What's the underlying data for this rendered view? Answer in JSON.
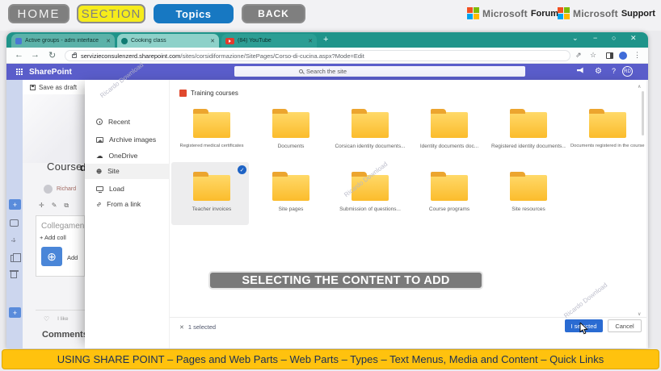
{
  "header": {
    "nav": [
      {
        "label": "HOME"
      },
      {
        "label": "SECTION"
      },
      {
        "label": "Topics"
      },
      {
        "label": "BACK"
      }
    ],
    "brands": [
      {
        "brand": "Microsoft",
        "label": "Forum"
      },
      {
        "brand": "Microsoft",
        "label": "Support"
      }
    ]
  },
  "browser": {
    "tabs": [
      {
        "title": "Active groups - adm interface"
      },
      {
        "title": "Cooking class"
      },
      {
        "title": "(84) YouTube"
      }
    ],
    "url_domain": "servizieconsulenzerd.sharepoint.com",
    "url_path": "/sites/corsidiformazione/SitePages/Corso-di-cucina.aspx?Mode=Edit"
  },
  "suitebar": {
    "app_name": "SharePoint",
    "search_placeholder": "Search the site",
    "avatar_initials": "RD"
  },
  "editor": {
    "save_as_draft": "Save as draft",
    "title": "Course",
    "title_overflow": "d",
    "author": "Richard",
    "links_heading": "Collegamen",
    "add_link": "+ Add coll",
    "add_button": "Add",
    "like_label": "I like",
    "comments_label": "Comments"
  },
  "picker": {
    "sidebar": [
      {
        "label": "Recent"
      },
      {
        "label": "Archive images"
      },
      {
        "label": "OneDrive"
      },
      {
        "label": "Site"
      },
      {
        "label": "Load"
      },
      {
        "label": "From a link"
      }
    ],
    "breadcrumb": "Training courses",
    "folders_row1": [
      "Registered medical certificates",
      "Documents",
      "Corsican identity documents...",
      "Identity documents doc...",
      "Registered identity documents...",
      "Documents registered in the course..."
    ],
    "folders_row2": [
      "Teacher invoices",
      "Site pages",
      "Submission of questions...",
      "Course programs",
      "Site resources"
    ],
    "selection_status": "1 selected",
    "select_button": "I selected",
    "cancel_button": "Cancel"
  },
  "overlay": {
    "banner": "SELECTING THE CONTENT TO ADD",
    "watermark": "Ricardo Download"
  },
  "footer": {
    "text": "USING SHARE POINT – Pages and Web Parts – Web Parts – Types – Text Menus, Media and Content – Quick Links"
  },
  "colors": {
    "suitebar_purple": "#5a5dca",
    "browser_teal": "#1f948a",
    "folder_yellow": "#fbbc2c",
    "accent_blue": "#2a6bd2",
    "footer_amber": "#ffc20e",
    "banner_gray": "#7a7a7a"
  }
}
